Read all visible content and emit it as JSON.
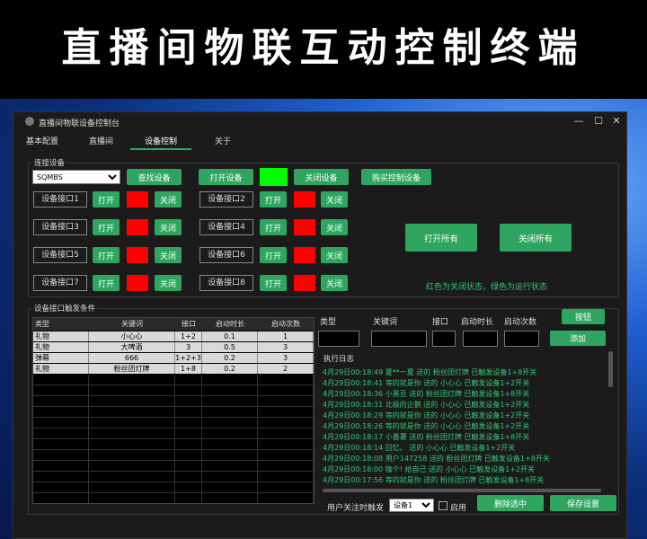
{
  "banner": "直播间物联互动控制终端",
  "window": {
    "title": "直播间物联设备控制台",
    "controls": [
      "—",
      "☐",
      "✕"
    ]
  },
  "tabs": [
    "基本配置",
    "直播间",
    "设备控制",
    "关于"
  ],
  "active_tab": "设备控制",
  "connect": {
    "group_title": "连接设备",
    "device_selected": "SQMBS",
    "find_btn": "查找设备",
    "open_btn": "打开设备",
    "close_btn": "关闭设备",
    "buy_btn": "购买控制设备",
    "status_color": "#00ff00"
  },
  "ports": [
    {
      "label": "设备接口1",
      "open": "打开",
      "close": "关闭",
      "state_color": "#ff0000"
    },
    {
      "label": "设备接口2",
      "open": "打开",
      "close": "关闭",
      "state_color": "#ff0000"
    },
    {
      "label": "设备接口3",
      "open": "打开",
      "close": "关闭",
      "state_color": "#ff0000"
    },
    {
      "label": "设备接口4",
      "open": "打开",
      "close": "关闭",
      "state_color": "#ff0000"
    },
    {
      "label": "设备接口5",
      "open": "打开",
      "close": "关闭",
      "state_color": "#ff0000"
    },
    {
      "label": "设备接口6",
      "open": "打开",
      "close": "关闭",
      "state_color": "#ff0000"
    },
    {
      "label": "设备接口7",
      "open": "打开",
      "close": "关闭",
      "state_color": "#ff0000"
    },
    {
      "label": "设备接口8",
      "open": "打开",
      "close": "关闭",
      "state_color": "#ff0000"
    }
  ],
  "open_all": "打开所有",
  "close_all": "关闭所有",
  "legend_note": "红色为关闭状态，绿色为运行状态",
  "trigger": {
    "group_title": "设备接口触发条件",
    "columns": [
      "类型",
      "关键词",
      "接口",
      "启动时长",
      "启动次数"
    ],
    "rows": [
      [
        "礼物",
        "小心心",
        "1+2",
        "0.1",
        "1"
      ],
      [
        "礼物",
        "大啤酒",
        "3",
        "0.5",
        "3"
      ],
      [
        "弹幕",
        "666",
        "1+2+3",
        "0.2",
        "3"
      ],
      [
        "礼物",
        "粉丝团灯牌",
        "1+8",
        "0.2",
        "2"
      ]
    ],
    "form_labels": [
      "类型",
      "关键词",
      "接口",
      "启动时长",
      "启动次数"
    ],
    "button_btn": "按钮",
    "add_btn": "添加"
  },
  "log": {
    "title": "执行日志",
    "lines": [
      "4月29日00:18:49  夏**一夏 送的 粉丝团灯牌 已触发设备1+8开关",
      "4月29日00:18:41  等的就是你 送的 小心心 已触发设备1+2开关",
      "4月29日00:18:36  小黑豆 送的 粉丝团灯牌 已触发设备1+8开关",
      "4月29日00:18:31  北极的企鹅 送的 小心心 已触发设备1+2开关",
      "4月29日00:18:29  等的就是你 送的 小心心 已触发设备1+2开关",
      "4月29日00:18:26  等的就是你 送的 小心心 已触发设备1+2开关",
      "4月29日00:18:17  小番薯 送的 粉丝团灯牌 已触发设备1+8开关",
      "4月29日00:18:14  回忆。 送的 小心心 已触发设备1+2开关",
      "4月29日00:18:08  用户147258 送的 粉丝团灯牌 已触发设备1+8开关",
      "4月29日00:18:00  咖个! 给自己 送的 小心心 已触发设备1+2开关",
      "4月29日00:17:56  等的就是你 送的 粉丝团灯牌 已触发设备1+8开关"
    ]
  },
  "footer": {
    "follow_label": "用户关注时触发",
    "follow_select": "设备1",
    "enable_label": "启用",
    "delete_btn": "删除选中",
    "save_btn": "保存设置"
  }
}
